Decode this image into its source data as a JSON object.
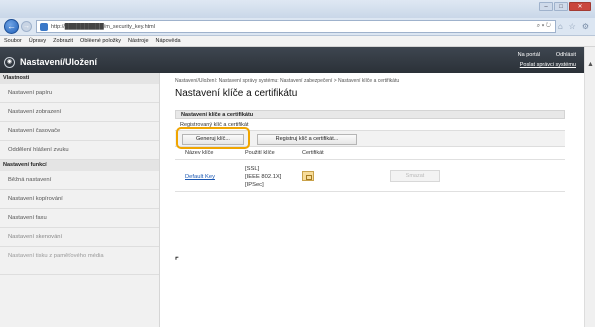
{
  "browser": {
    "url": "http://██████████/m_security_key.html",
    "address_icons": "⌕ ▾ ↻",
    "window_buttons": [
      "–",
      "□",
      "✕"
    ]
  },
  "menubar": [
    "Soubor",
    "Úpravy",
    "Zobrazit",
    "Oblëené položky",
    "Nástroje",
    "Nápověda"
  ],
  "app": {
    "title": "Nastavení/Uložení",
    "portal_link": "Na portál",
    "logout_link": "Odhlásit",
    "mail_link": "Poslat správci systému"
  },
  "sidebar": {
    "section1": "Vlastnosti",
    "items1": [
      "Nastavení papíru",
      "Nastavení zobrazení",
      "Nastavení časovače",
      "Oddělení hlášení zvuku"
    ],
    "section2": "Nastavení funkcí",
    "items2": [
      "Běžná nastavení",
      "Nastavení kopírování",
      "Nastavení faxu",
      "Nastavení skenování",
      "Nastavení tisku z paměťového média"
    ]
  },
  "main": {
    "breadcrumb": "Nastavení/Uložení: Nastavení správy systému: Nastavení zabezpečení > Nastavení klíče a certifikátu",
    "page_title": "Nastavení klíče a certifikátu",
    "panel_title": "Nastavení klíče a certifikátu",
    "sub_title": "Registrovaný klíč a certifikát",
    "generate_button": "Generuj klíč...",
    "register_button": "Registruj klíč a certifikát...",
    "columns": [
      "Název klíče",
      "Použití klíče",
      "Certifikát"
    ],
    "row": {
      "key_name": "Default Key",
      "usage": "[SSL]\n[IEEE 802.1X]\n[IPSec]",
      "delete_button": "Smazat"
    }
  },
  "colors": {
    "accent": "#f0a500",
    "link": "#1a57b2",
    "header": "#2b3138"
  }
}
